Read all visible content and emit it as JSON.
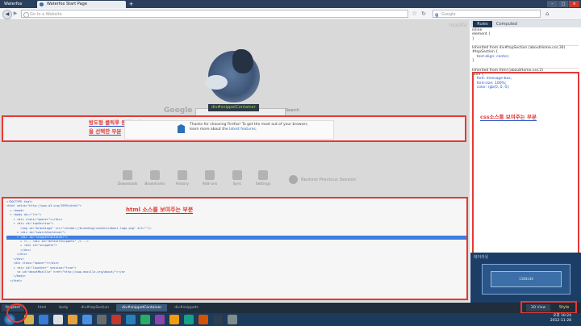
{
  "browser": {
    "app_button": "Waterfox",
    "tab_title": "Waterfox Start Page",
    "new_tab": "+",
    "window_buttons": [
      "–",
      "□",
      "×"
    ],
    "url_placeholder": "Go to a Website",
    "search_placeholder": "Google",
    "search_engine_icon": "g",
    "back_icon": "◀",
    "forward_icon": "▶",
    "star_icon": "☆",
    "reload_icon": "↻",
    "home_icon": "⌂"
  },
  "page": {
    "mozilla_word": "mozilla",
    "google_label": "Google",
    "search_button": "Search",
    "tooltip": "div#snippetContainer",
    "snippet_text_1": "Thanks for choosing Firefox! To get the most out of your browser,",
    "snippet_text_2": "learn more about the ",
    "snippet_link": "latest features",
    "snippet_end": ".",
    "launcher": [
      "Downloads",
      "Bookmarks",
      "History",
      "Add-ons",
      "Sync",
      "Settings"
    ],
    "restore": "Restore Previous Session"
  },
  "annotations": {
    "snippet_line1": "방도형 클릭후 원하는 곳",
    "snippet_line2": "을 선택한 부분",
    "html_note": "html 소스를 보여주는 부분",
    "css_note": "css소스를 보여주는 부분"
  },
  "html_source": [
    "<!DOCTYPE html>",
    "<html xmlns=\"http://www.w3.org/1999/xhtml\">",
    "  ▸ <head>",
    "  ▾ <body dir=\"ltr\">",
    "    ▾ <div class=\"spacer\"></div>",
    "    ▾ <div id=\"topSection\">",
    "        <img id=\"brandLogo\" src=\"chrome://branding/content/about-logo.png\" alt=\"\"/>",
    "      ▸ <div id=\"searchContainer\">",
    "      ▾ <div id=\"snippetContainer\">",
    "        ▸ <!-- <div id=\"defaultSnippets\" /> -->",
    "        ▸ <div id=\"snippets\">",
    "        </div>",
    "      </div>",
    "    </div>",
    "    <div class=\"spacer\"></div>",
    "    ▸ <div id=\"launcher\" session=\"true\">",
    "      <a id=\"aboutMozilla\" href=\"http://www.mozilla.org/about/\"></a>",
    "    </body>",
    "  </html>"
  ],
  "html_selected_line": 8,
  "css_panel": {
    "tabs": [
      "Rules",
      "Computed"
    ],
    "active_tab": "Rules",
    "rules": [
      "inline",
      "element {",
      "}",
      "",
      "Inherited from div#topSection (aboutHome.css:30)",
      "#topSection {",
      "    text-align: center;",
      "}",
      "",
      "Inherited from html (aboutHome.css:2)",
      "html {",
      "    font: message-box;",
      "    font-size: 100%;",
      "    color: rgb(0, 0, 0);",
      "}"
    ]
  },
  "layout_panel": {
    "title": "레이아웃",
    "box_label": "1184x34"
  },
  "devtools_bar": {
    "inspect": "Inspect",
    "crumbs": [
      "html",
      "body",
      "div#topSection",
      "div#snippetContainer",
      "div#snippets"
    ],
    "active_crumb": 3,
    "view3d": "3D View",
    "style": "Style"
  },
  "taskbar": {
    "clock_time": "오후 10:24",
    "clock_date": "2012-11-28"
  },
  "colors": {
    "annotation_red": "#e53935",
    "annotation_underline": "#2b56c8",
    "selection_blue": "#3d7ee0",
    "devtools_dark": "#202d3b"
  }
}
